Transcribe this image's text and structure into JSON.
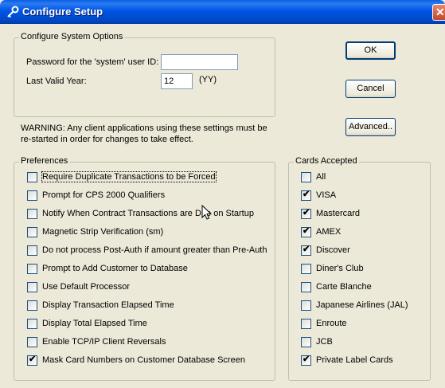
{
  "window": {
    "title": "Configure Setup",
    "close_glyph": "✕"
  },
  "system_options": {
    "legend": "Configure System Options",
    "password_label": "Password for the 'system' user ID:",
    "password_value": "",
    "last_year_label": "Last Valid Year:",
    "last_year_value": "12",
    "last_year_hint": "(YY)"
  },
  "buttons": {
    "ok": "OK",
    "cancel": "Cancel",
    "advanced": "Advanced.."
  },
  "warning": {
    "line1": "WARNING:  Any client applications using these settings must be",
    "line2": "re-started in order for changes to take effect."
  },
  "preferences": {
    "legend": "Preferences",
    "items": [
      {
        "label": "Require Duplicate Transactions to be Forced",
        "checked": false
      },
      {
        "label": "Prompt for CPS 2000 Qualifiers",
        "checked": false
      },
      {
        "label": "Notify When Contract Transactions are Due on Startup",
        "checked": false
      },
      {
        "label": "Magnetic Strip Verification (sm)",
        "checked": false
      },
      {
        "label": "Do not process Post-Auth if amount greater than Pre-Auth",
        "checked": false
      },
      {
        "label": "Prompt to Add Customer to Database",
        "checked": false
      },
      {
        "label": "Use Default Processor",
        "checked": false
      },
      {
        "label": "Display Transaction Elapsed Time",
        "checked": false
      },
      {
        "label": "Display Total Elapsed Time",
        "checked": false
      },
      {
        "label": "Enable TCP/IP Client Reversals",
        "checked": false
      },
      {
        "label": "Mask Card Numbers on Customer Database Screen",
        "checked": true
      }
    ]
  },
  "cards": {
    "legend": "Cards Accepted",
    "items": [
      {
        "label": "All",
        "checked": false
      },
      {
        "label": "VISA",
        "checked": true
      },
      {
        "label": "Mastercard",
        "checked": true
      },
      {
        "label": "AMEX",
        "checked": true
      },
      {
        "label": "Discover",
        "checked": true
      },
      {
        "label": "Diner's Club",
        "checked": false
      },
      {
        "label": "Carte Blanche",
        "checked": false
      },
      {
        "label": "Japanese Airlines (JAL)",
        "checked": false
      },
      {
        "label": "Enroute",
        "checked": false
      },
      {
        "label": "JCB",
        "checked": false
      },
      {
        "label": "Private Label Cards",
        "checked": true
      }
    ]
  },
  "check_glyph": "✔"
}
